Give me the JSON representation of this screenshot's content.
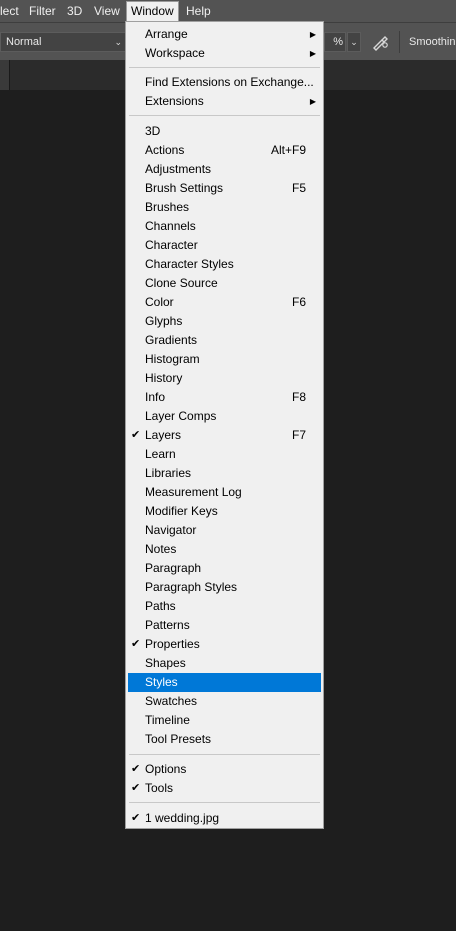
{
  "menubar": {
    "items": [
      "lect",
      "Filter",
      "3D",
      "View",
      "Window",
      "Help"
    ]
  },
  "options": {
    "mode": "Normal",
    "percent": "%",
    "smoothing_label": "Smoothing"
  },
  "window_menu": {
    "arrange": "Arrange",
    "workspace": "Workspace",
    "find_extensions": "Find Extensions on Exchange...",
    "extensions": "Extensions",
    "panels": [
      {
        "label": "3D",
        "shortcut": "",
        "checked": false
      },
      {
        "label": "Actions",
        "shortcut": "Alt+F9",
        "checked": false
      },
      {
        "label": "Adjustments",
        "shortcut": "",
        "checked": false
      },
      {
        "label": "Brush Settings",
        "shortcut": "F5",
        "checked": false
      },
      {
        "label": "Brushes",
        "shortcut": "",
        "checked": false
      },
      {
        "label": "Channels",
        "shortcut": "",
        "checked": false
      },
      {
        "label": "Character",
        "shortcut": "",
        "checked": false
      },
      {
        "label": "Character Styles",
        "shortcut": "",
        "checked": false
      },
      {
        "label": "Clone Source",
        "shortcut": "",
        "checked": false
      },
      {
        "label": "Color",
        "shortcut": "F6",
        "checked": false
      },
      {
        "label": "Glyphs",
        "shortcut": "",
        "checked": false
      },
      {
        "label": "Gradients",
        "shortcut": "",
        "checked": false
      },
      {
        "label": "Histogram",
        "shortcut": "",
        "checked": false
      },
      {
        "label": "History",
        "shortcut": "",
        "checked": false
      },
      {
        "label": "Info",
        "shortcut": "F8",
        "checked": false
      },
      {
        "label": "Layer Comps",
        "shortcut": "",
        "checked": false
      },
      {
        "label": "Layers",
        "shortcut": "F7",
        "checked": true
      },
      {
        "label": "Learn",
        "shortcut": "",
        "checked": false
      },
      {
        "label": "Libraries",
        "shortcut": "",
        "checked": false
      },
      {
        "label": "Measurement Log",
        "shortcut": "",
        "checked": false
      },
      {
        "label": "Modifier Keys",
        "shortcut": "",
        "checked": false
      },
      {
        "label": "Navigator",
        "shortcut": "",
        "checked": false
      },
      {
        "label": "Notes",
        "shortcut": "",
        "checked": false
      },
      {
        "label": "Paragraph",
        "shortcut": "",
        "checked": false
      },
      {
        "label": "Paragraph Styles",
        "shortcut": "",
        "checked": false
      },
      {
        "label": "Paths",
        "shortcut": "",
        "checked": false
      },
      {
        "label": "Patterns",
        "shortcut": "",
        "checked": false
      },
      {
        "label": "Properties",
        "shortcut": "",
        "checked": true
      },
      {
        "label": "Shapes",
        "shortcut": "",
        "checked": false
      },
      {
        "label": "Styles",
        "shortcut": "",
        "checked": false,
        "highlighted": true
      },
      {
        "label": "Swatches",
        "shortcut": "",
        "checked": false
      },
      {
        "label": "Timeline",
        "shortcut": "",
        "checked": false
      },
      {
        "label": "Tool Presets",
        "shortcut": "",
        "checked": false
      }
    ],
    "options": {
      "label": "Options",
      "checked": true
    },
    "tools": {
      "label": "Tools",
      "checked": true
    },
    "document": {
      "label": "1 wedding.jpg",
      "checked": true
    },
    "check_glyph": "✔",
    "submenu_glyph": "▶"
  },
  "colors": {
    "highlight": "#0078d7",
    "menu_bg": "#f0f0f0",
    "chrome": "#535353",
    "workspace": "#1e1e1e"
  }
}
